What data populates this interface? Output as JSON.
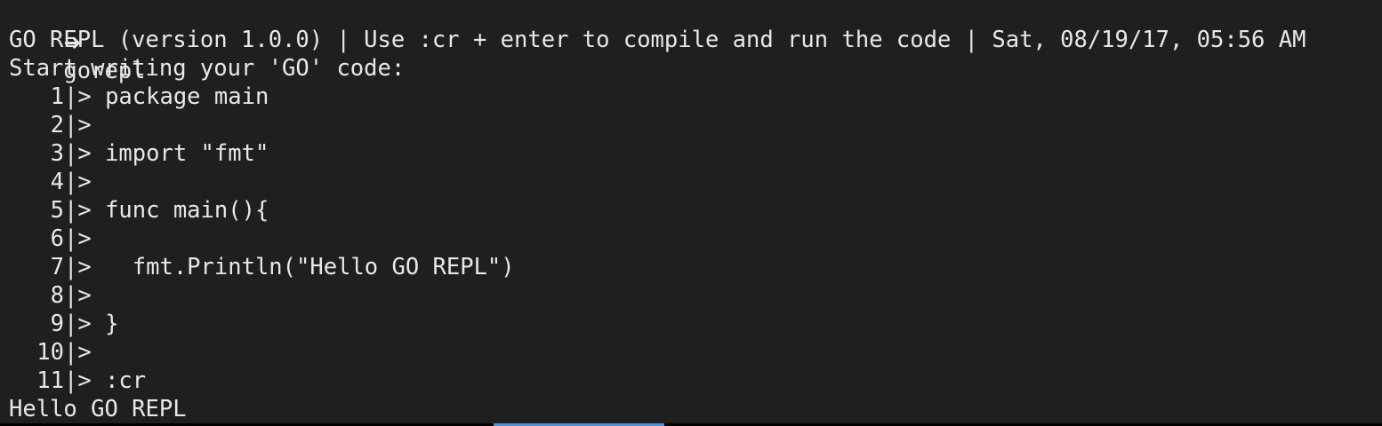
{
  "prompt": {
    "arrow": "➜",
    "command": "gorepl"
  },
  "banner": "GO REPL (version 1.0.0) | Use :cr + enter to compile and run the code | Sat, 08/19/17, 05:56 AM",
  "start_message": "Start writing your 'GO' code:",
  "code_lines": [
    {
      "num": "1",
      "text": "package main"
    },
    {
      "num": "2",
      "text": ""
    },
    {
      "num": "3",
      "text": "import \"fmt\""
    },
    {
      "num": "4",
      "text": ""
    },
    {
      "num": "5",
      "text": "func main(){"
    },
    {
      "num": "6",
      "text": ""
    },
    {
      "num": "7",
      "text": "  fmt.Println(\"Hello GO REPL\")"
    },
    {
      "num": "8",
      "text": ""
    },
    {
      "num": "9",
      "text": "}"
    },
    {
      "num": "10",
      "text": ""
    },
    {
      "num": "11",
      "text": ":cr"
    }
  ],
  "line_marker": "|> ",
  "output": "Hello GO REPL",
  "colors": {
    "background": "#1f1f1f",
    "foreground": "#e8e8e8",
    "selection": "#4a90e2"
  }
}
